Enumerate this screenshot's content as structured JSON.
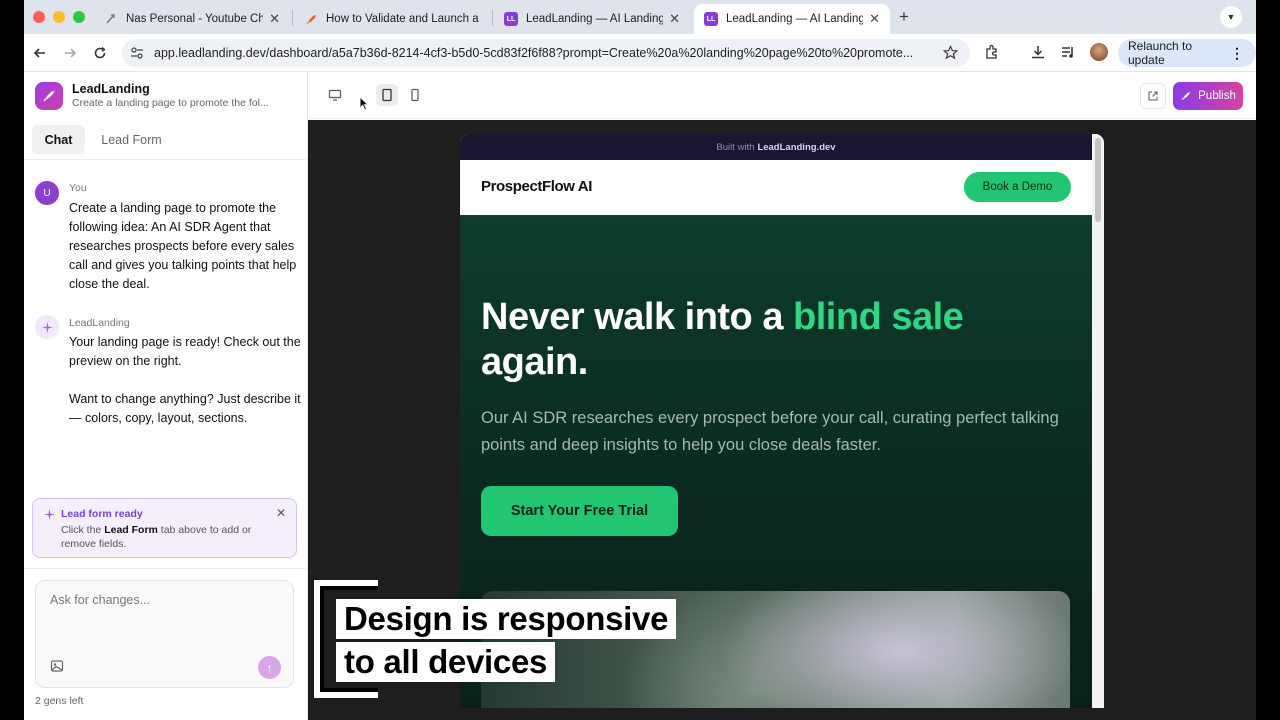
{
  "browser": {
    "tabs": [
      {
        "label": "Nas Personal - Youtube Chan",
        "favicon_color": "#6b7c93",
        "active": false
      },
      {
        "label": "How to Validate and Launch a",
        "favicon_color": "#e8612c",
        "active": false
      },
      {
        "label": "LeadLanding — AI Landing Pa",
        "favicon_color": "#8a3bd8",
        "active": false
      },
      {
        "label": "LeadLanding — AI Landing Pa",
        "favicon_color": "#8a3bd8",
        "active": true
      }
    ],
    "favicon_text": "LL",
    "url": "app.leadlanding.dev/dashboard/a5a7b36d-8214-4cf3-b5d0-5cd83f2f6f88?prompt=Create%20a%20landing%20page%20to%20promote...",
    "relaunch_label": "Relaunch to update"
  },
  "sidebar": {
    "app_name": "LeadLanding",
    "app_subtitle": "Create a landing page to promote the fol...",
    "tabs": [
      {
        "label": "Chat",
        "active": true
      },
      {
        "label": "Lead Form",
        "active": false
      }
    ],
    "messages": [
      {
        "author": "You",
        "avatar": "U",
        "text": "Create a landing page to promote the following idea: An AI SDR Agent that researches prospects before every sales call and gives you talking points that help close the deal."
      },
      {
        "author": "LeadLanding",
        "text_1": "Your landing page is ready! Check out the preview on the right.",
        "text_2": "Want to change anything? Just describe it — colors, copy, layout, sections."
      }
    ],
    "lead_card": {
      "title": "Lead form ready",
      "body_prefix": "Click the",
      "body_bold": "Lead Form",
      "body_suffix": "tab above to add or remove fields."
    },
    "composer_placeholder": "Ask for changes...",
    "gens_left": "2 gens left"
  },
  "preview": {
    "publish_label": "Publish",
    "built_with_prefix": "Built with",
    "built_with_brand": "LeadLanding.dev",
    "brand": "ProspectFlow AI",
    "demo_button": "Book a Demo",
    "hero_title_1": "Never walk into a",
    "hero_title_highlight": "blind sale",
    "hero_title_2": "again.",
    "hero_subtitle": "Our AI SDR researches every prospect before your call, curating perfect talking points and deep insights to help you close deals faster.",
    "cta": "Start Your Free Trial"
  },
  "caption": {
    "line1": "Design is responsive",
    "line2": "to all devices"
  },
  "colors": {
    "accent_green": "#22c571",
    "highlight_green": "#2fd784",
    "brand_purple": "#8b3be6",
    "brand_pink": "#d6419f"
  }
}
